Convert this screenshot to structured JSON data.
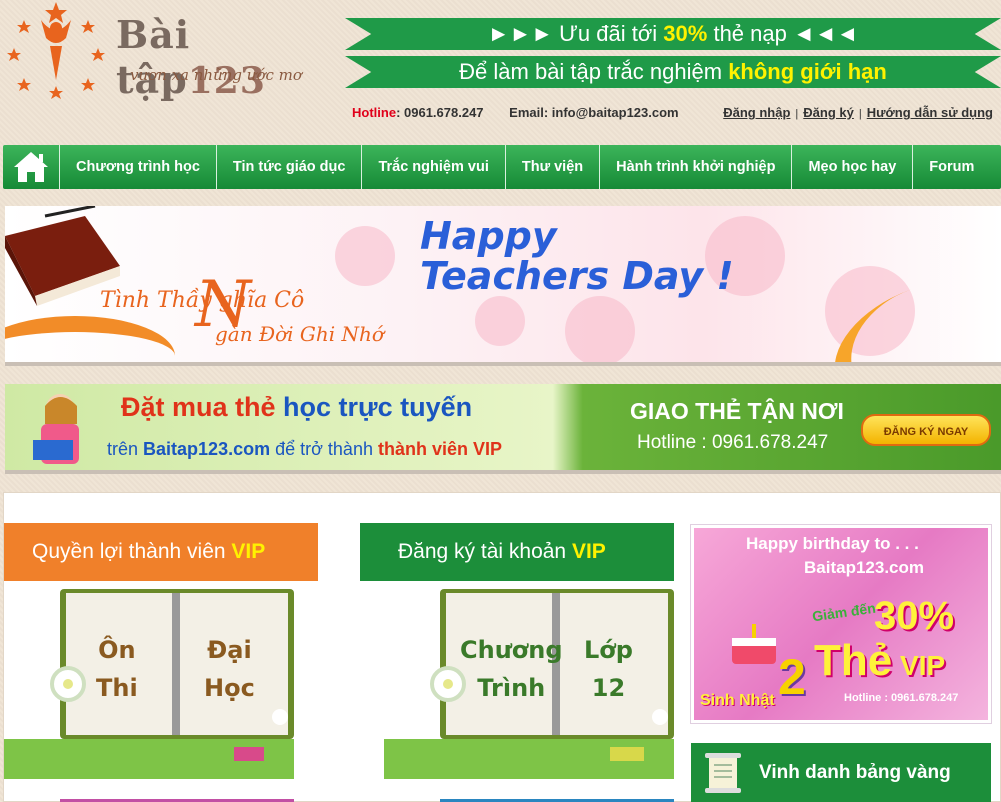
{
  "logo": {
    "name": "Bài tập",
    "number": "123",
    "slogan": "vươn xa những ước mơ"
  },
  "promo": {
    "line1_pre": "►►►  Ưu đãi tới ",
    "line1_highlight": "30%",
    "line1_post": " thẻ nạp  ◄◄◄",
    "line2_pre": "Để làm bài tập trắc nghiệm ",
    "line2_highlight": "không giới hạn"
  },
  "contact": {
    "hotline_label": "Hotline",
    "hotline_value": ": 0961.678.247",
    "email": "Email: info@baitap123.com"
  },
  "auth": {
    "login": "Đăng nhập",
    "register": "Đăng ký",
    "guide": "Hướng dẫn sử dụng"
  },
  "nav": {
    "home_icon": "home-icon",
    "items": [
      "Chương trình học",
      "Tin tức giáo dục",
      "Trắc nghiệm vui",
      "Thư viện",
      "Hành trình khởi nghiệp",
      "Mẹo học hay",
      "Forum"
    ]
  },
  "banner_teacher": {
    "title_line1": "Happy",
    "title_line2": "Teachers Day !",
    "big_letter": "N",
    "sub1": "Tình Thầy    ghĩa Cô",
    "sub2": "gàn Đời Ghi Nhớ"
  },
  "banner_vip": {
    "t1_pre": "Đặt mua thẻ ",
    "t1_blue": "học trực tuyến",
    "t2_pre": "trên ",
    "t2_site": "Baitap123.com",
    "t2_mid": " để trở thành ",
    "t2_vip": "thành viên VIP",
    "r1": "GIAO THẺ TẬN NƠI",
    "r2": "Hotline : 0961.678.247",
    "button": "ĐĂNG KÝ NGAY"
  },
  "boxes": {
    "vip_benefits_pre": "Quyền lợi thành viên ",
    "vip_benefits_vip": "VIP",
    "vip_register_pre": "Đăng ký tài khoản ",
    "vip_register_vip": "VIP",
    "book1_left": "Ôn\nThi",
    "book1_right": "Đại\nHọc",
    "book2_left": "Chương\nTrình",
    "book2_right": "Lớp\n12"
  },
  "birthday": {
    "l1": "Happy birthday to . . .",
    "l2": "Baitap123.com",
    "l3": "Giảm đến",
    "l4": "30%",
    "l5_big": "Thẻ",
    "l5_small": " VIP",
    "l6": "Hotline : 0961.678.247",
    "two": "2",
    "lucky": "Sinh Nhật"
  },
  "honor": {
    "label": "Vinh danh bảng vàng"
  },
  "colors": {
    "nav_green": "#168a36",
    "orange": "#f0802a",
    "green": "#1c8e3a",
    "hotline_red": "#e0001a"
  }
}
